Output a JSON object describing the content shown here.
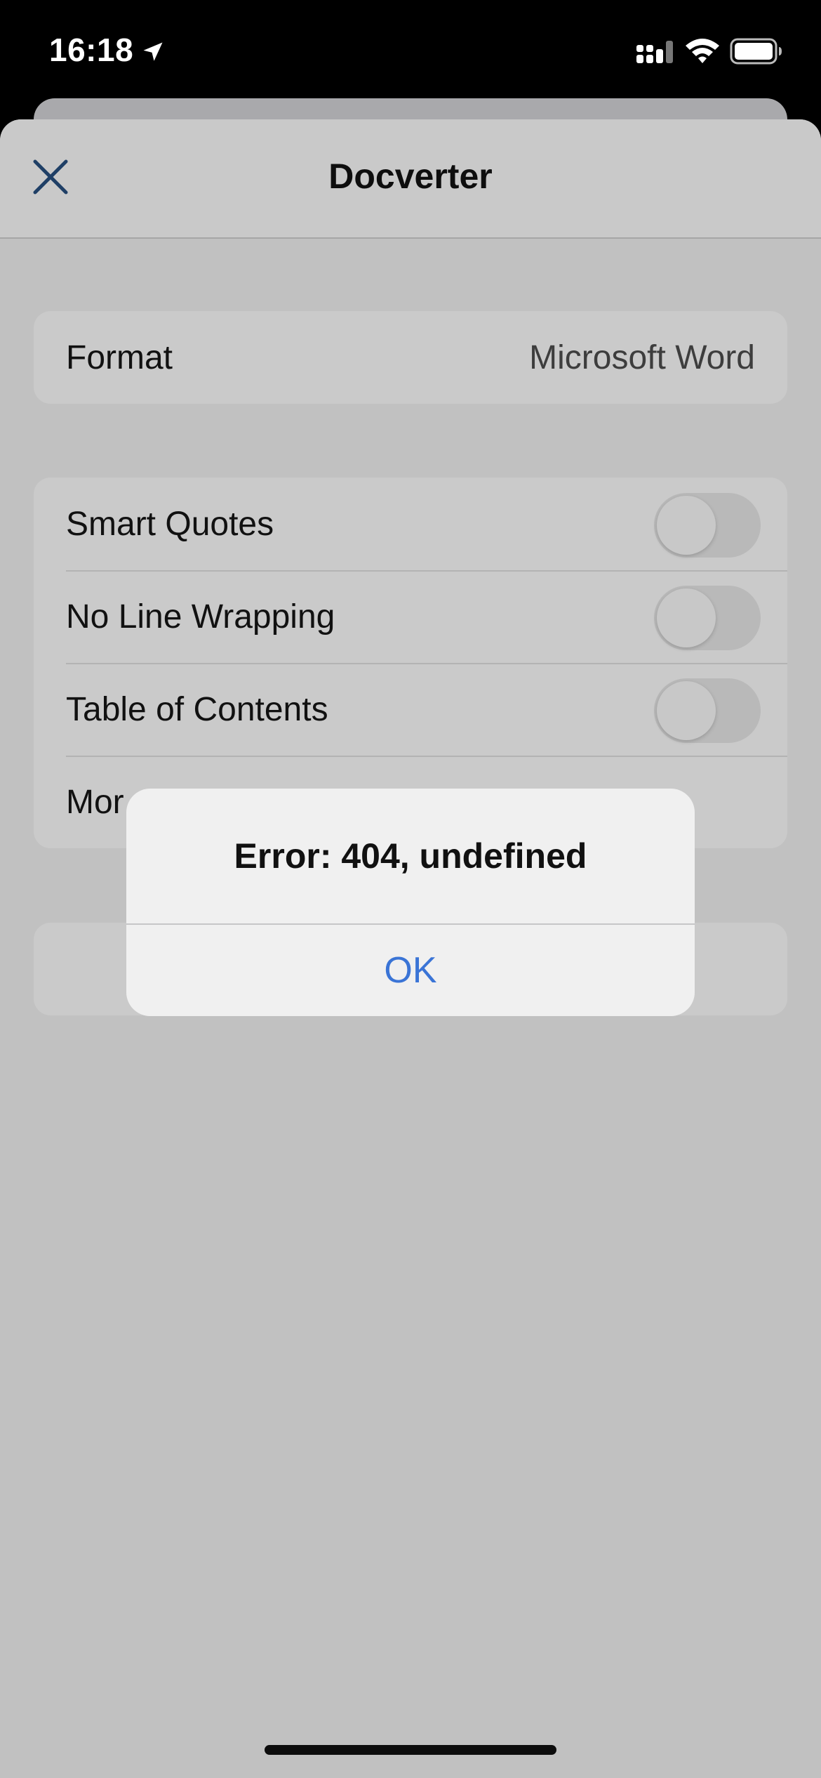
{
  "status_bar": {
    "time": "16:18",
    "icons": [
      "location-arrow-icon",
      "cellular-signal-icon",
      "wifi-icon",
      "battery-icon"
    ]
  },
  "nav": {
    "title": "Docverter",
    "close_icon": "close-icon"
  },
  "format_row": {
    "label": "Format",
    "value": "Microsoft Word"
  },
  "options": [
    {
      "label": "Smart Quotes",
      "enabled": false
    },
    {
      "label": "No Line Wrapping",
      "enabled": false
    },
    {
      "label": "Table of Contents",
      "enabled": false
    },
    {
      "label": "Mor"
    }
  ],
  "alert": {
    "title": "Error: 404, undefined",
    "button": "OK"
  },
  "colors": {
    "accent": "#3a74d6",
    "dimmed_background": "#c1c1c1",
    "alert_background": "#f0f0f0"
  }
}
